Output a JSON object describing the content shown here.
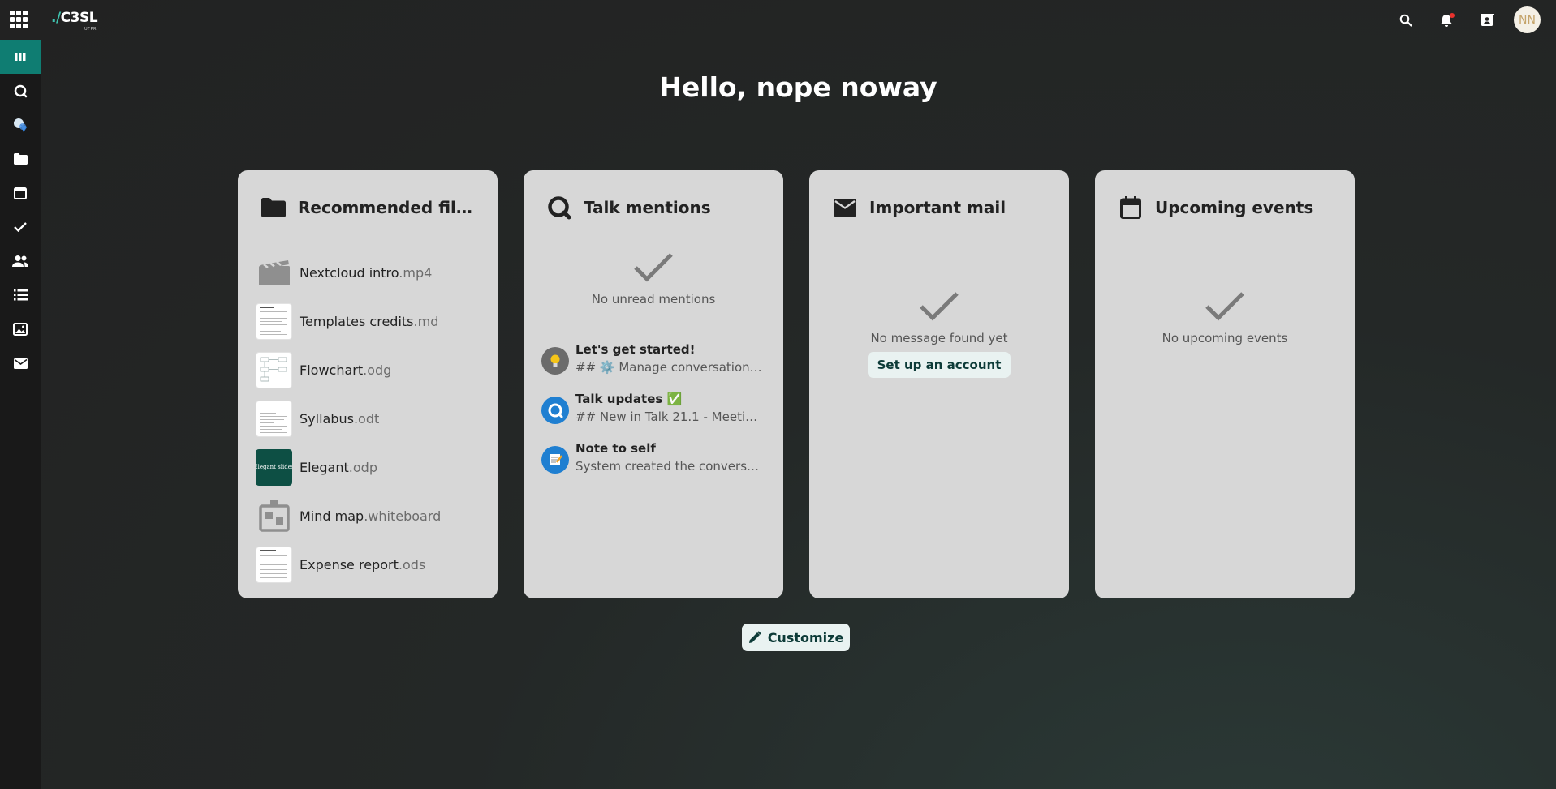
{
  "topbar": {
    "logo": {
      "prefix": "./",
      "name": "C3SL",
      "sub": "UFPR"
    },
    "avatar_initials": "NN"
  },
  "greeting": "Hello, nope noway",
  "panels": {
    "files": {
      "title": "Recommended fil…",
      "items": [
        {
          "name": "Nextcloud intro",
          "ext": ".mp4",
          "thumb": "video-icon"
        },
        {
          "name": "Templates credits",
          "ext": ".md",
          "thumb": "document-thumbnail"
        },
        {
          "name": "Flowchart",
          "ext": ".odg",
          "thumb": "flowchart-thumbnail"
        },
        {
          "name": "Syllabus",
          "ext": ".odt",
          "thumb": "document-thumbnail"
        },
        {
          "name": "Elegant",
          "ext": ".odp",
          "thumb": "presentation-thumbnail",
          "thumb_text": "Elegant slides"
        },
        {
          "name": "Mind map",
          "ext": ".whiteboard",
          "thumb": "whiteboard-icon"
        },
        {
          "name": "Expense report",
          "ext": ".ods",
          "thumb": "spreadsheet-thumbnail"
        }
      ]
    },
    "talk": {
      "title": "Talk mentions",
      "empty_text": "No unread mentions",
      "items": [
        {
          "title": "Let's get started!",
          "subtitle": "## ⚙️ Manage conversation…",
          "icon": "lightbulb-icon"
        },
        {
          "title": "Talk updates ✅",
          "subtitle": "## New in Talk 21.1 - Meeti…",
          "icon": "talk-icon"
        },
        {
          "title": "Note to self",
          "subtitle": "System created the convers…",
          "icon": "note-icon"
        }
      ]
    },
    "mail": {
      "title": "Important mail",
      "empty_text": "No message found yet",
      "button_label": "Set up an account"
    },
    "events": {
      "title": "Upcoming events",
      "empty_text": "No upcoming events"
    }
  },
  "customize_label": "Customize",
  "colors": {
    "accent": "#0f7d72",
    "panel": "#d7d7d7",
    "button_bg": "#e9f2f1"
  }
}
